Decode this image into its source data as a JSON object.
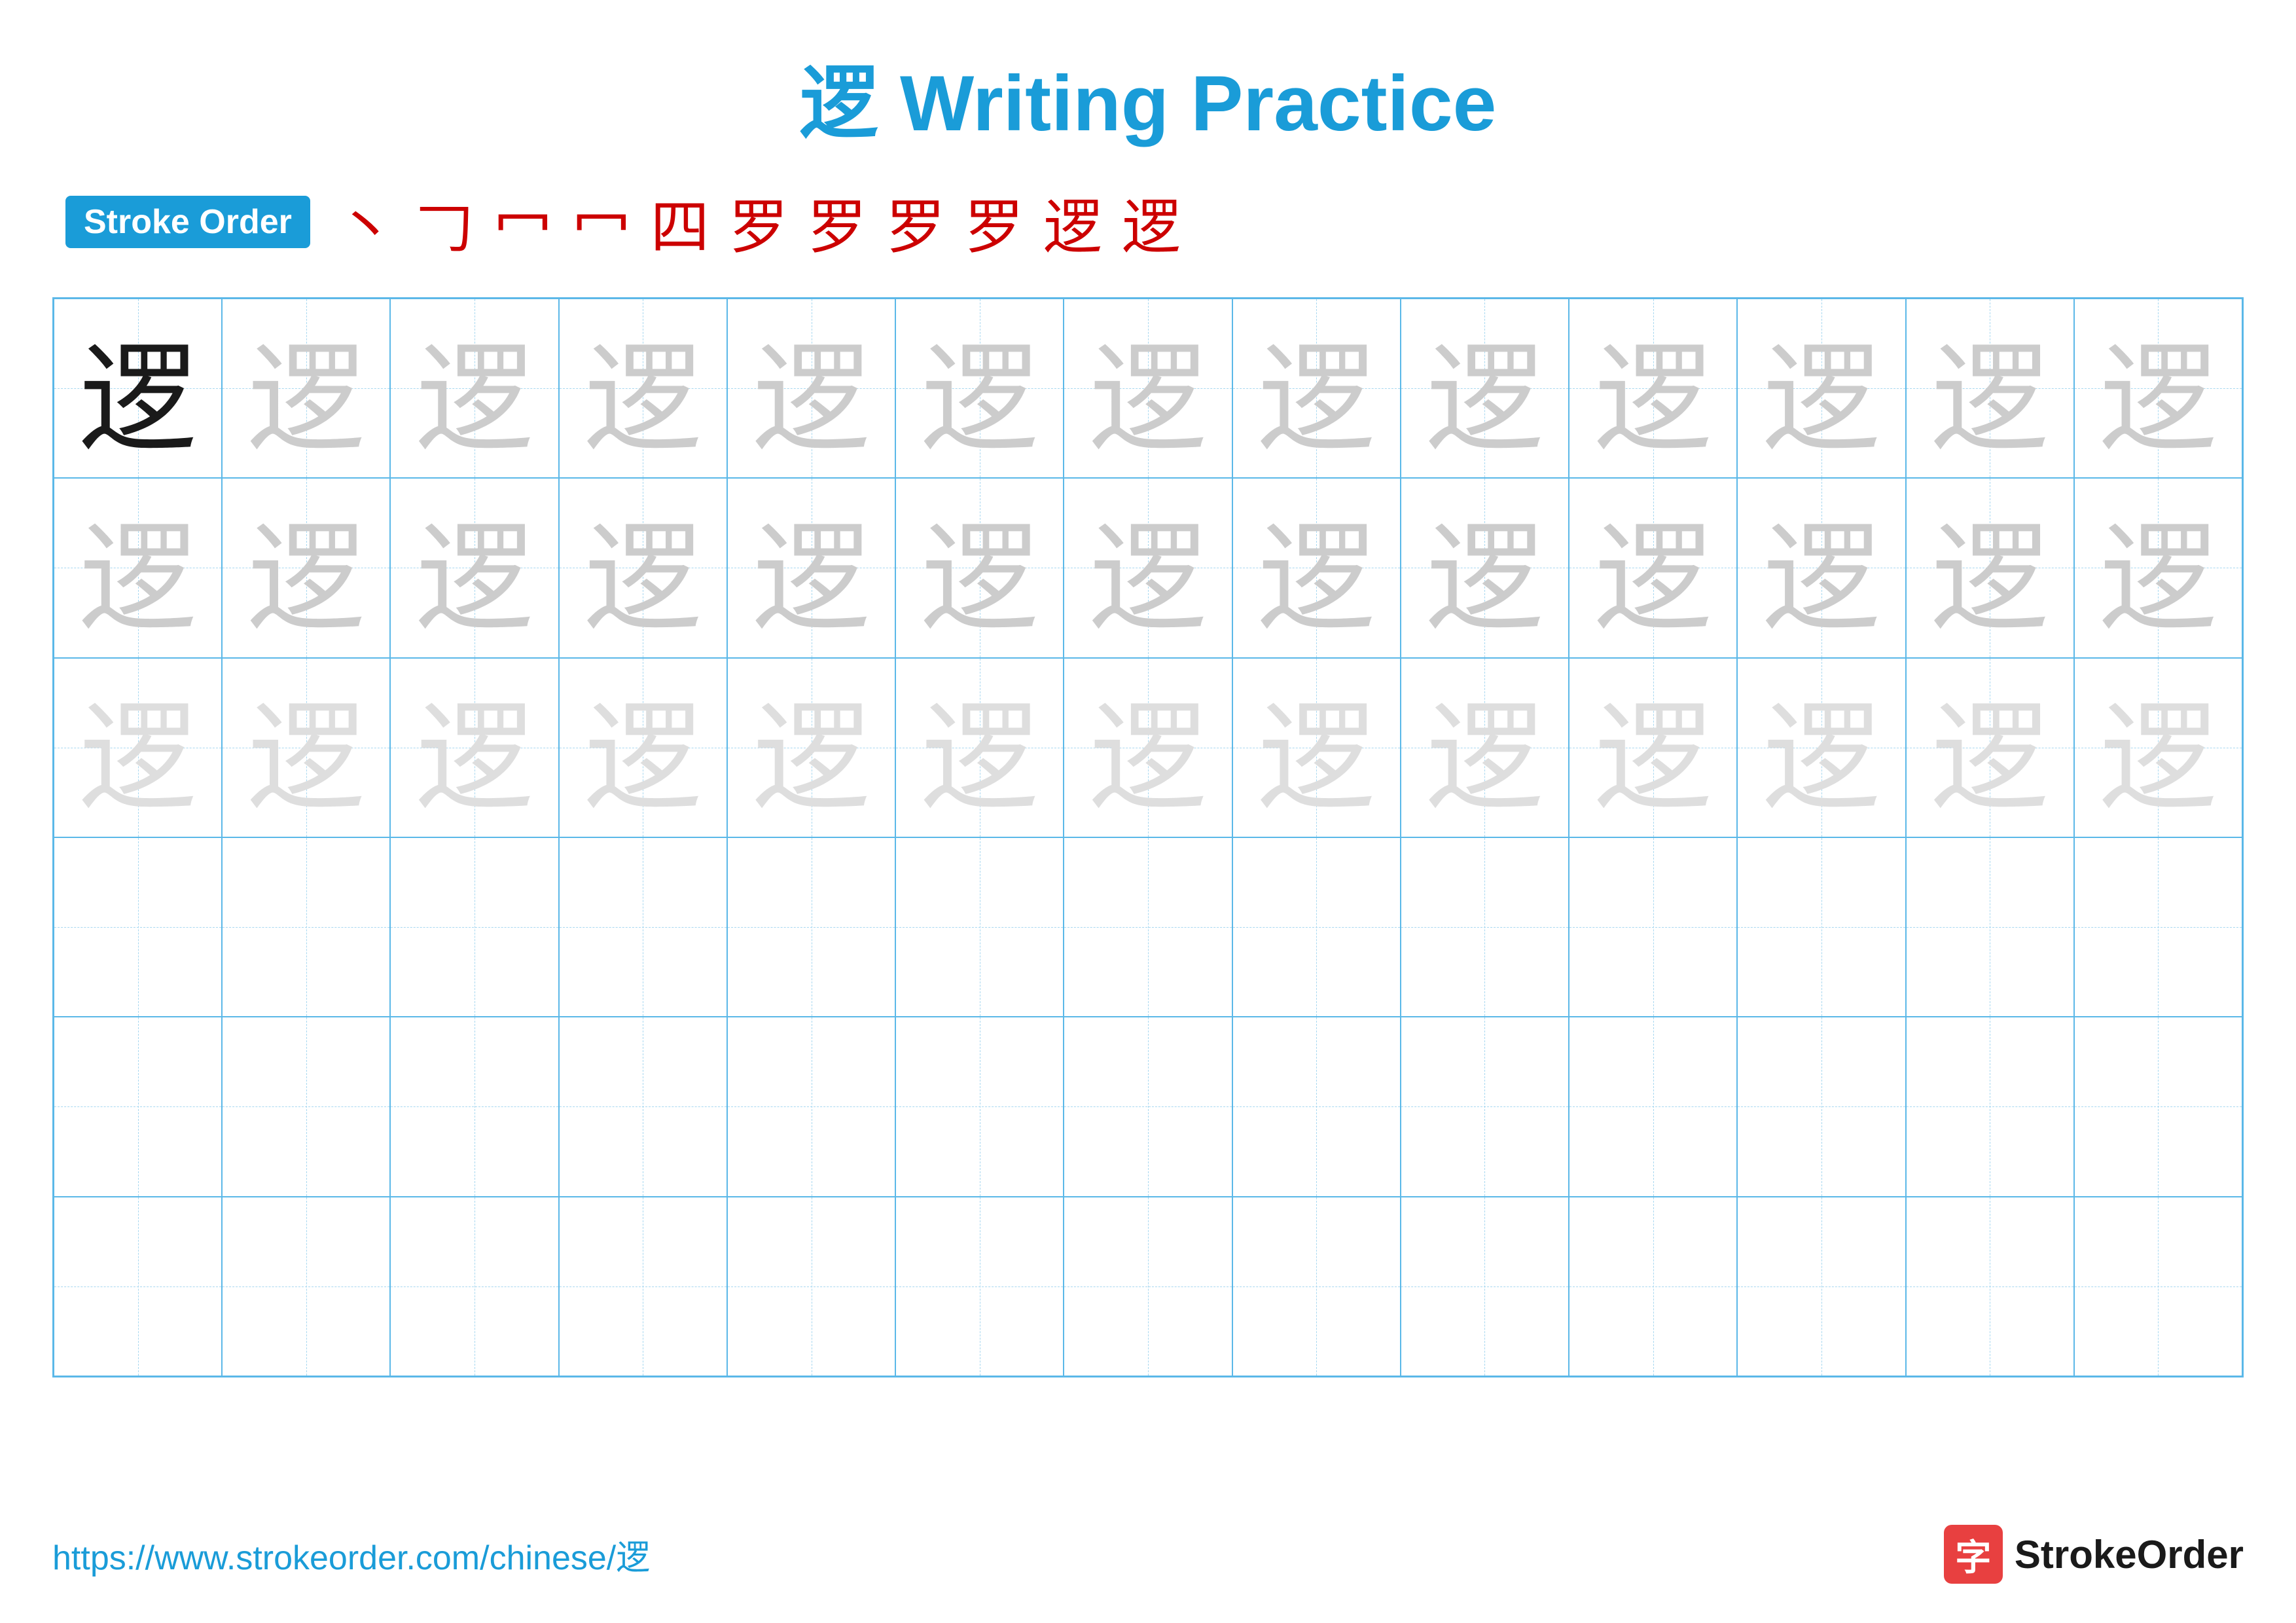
{
  "title": {
    "chinese_char": "逻",
    "text": " Writing Practice",
    "full": "逻 Writing Practice"
  },
  "stroke_order": {
    "badge_label": "Stroke Order",
    "strokes": [
      "丶",
      "𠃌",
      "冖",
      "冖",
      "四",
      "罗",
      "罗",
      "罗",
      "罗",
      "逻",
      "逻"
    ]
  },
  "grid": {
    "rows": 6,
    "cols": 13,
    "chars": {
      "dark": "逻",
      "light": "逻",
      "lighter": "逻"
    }
  },
  "footer": {
    "url": "https://www.strokeorder.com/chinese/逻",
    "logo_char": "字",
    "logo_text": "StrokeOrder"
  },
  "colors": {
    "blue": "#1a9cd8",
    "red": "#cc0000",
    "dark": "#1a1a1a",
    "light_char": "#cccccc",
    "lighter_char": "#dedede",
    "border": "#5bb8e8",
    "dashed": "#a8d8f0"
  }
}
